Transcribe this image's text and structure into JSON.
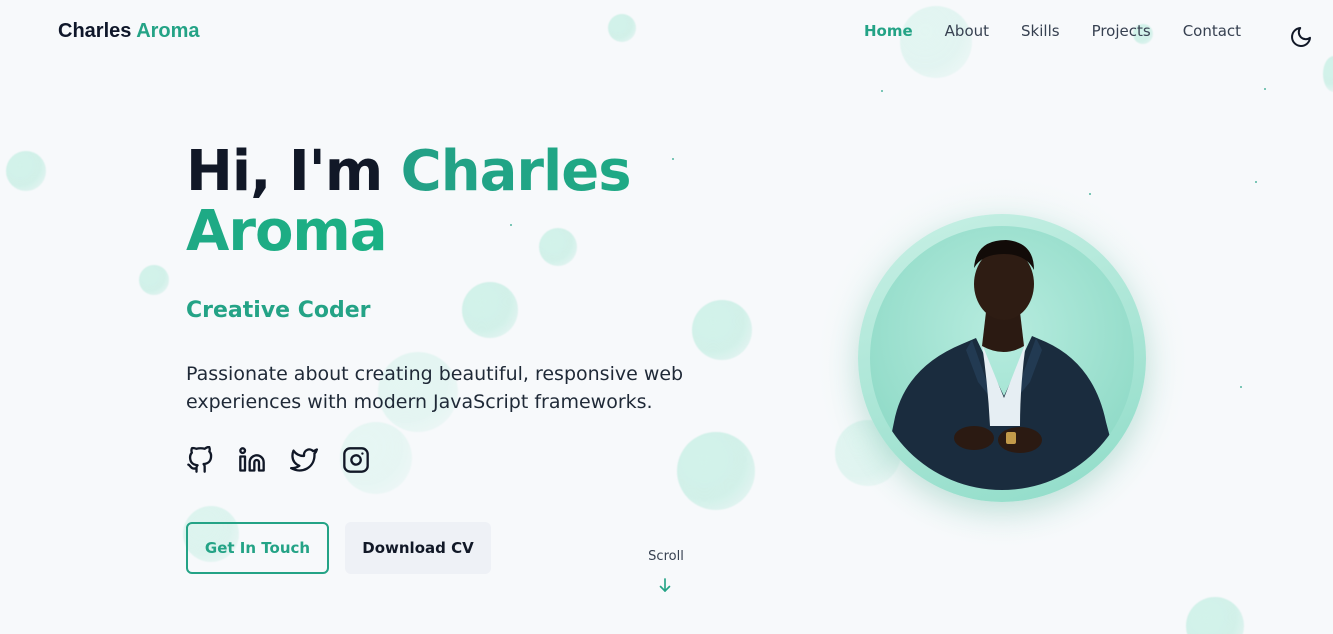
{
  "header": {
    "brand_first": "Charles",
    "brand_second": "Aroma",
    "nav": [
      "Home",
      "About",
      "Skills",
      "Projects",
      "Contact"
    ],
    "active_nav": "Home",
    "theme_toggle_icon": "moon-icon"
  },
  "hero": {
    "greeting": "Hi, I'm",
    "name": "Charles Aroma",
    "subtitle": "Creative Coder",
    "description": "Passionate about creating beautiful, responsive web experiences with modern JavaScript frameworks.",
    "socials": [
      "github-icon",
      "linkedin-icon",
      "twitter-icon",
      "instagram-icon"
    ],
    "primary_button": "Get In Touch",
    "secondary_button": "Download CV",
    "scroll_label": "Scroll",
    "scroll_icon": "arrow-down-icon",
    "portrait_icon": "profile-photo"
  },
  "colors": {
    "accent": "#24a386",
    "background": "#f7f9fb",
    "text": "#111827",
    "secondary_button_bg": "#eef1f6"
  }
}
